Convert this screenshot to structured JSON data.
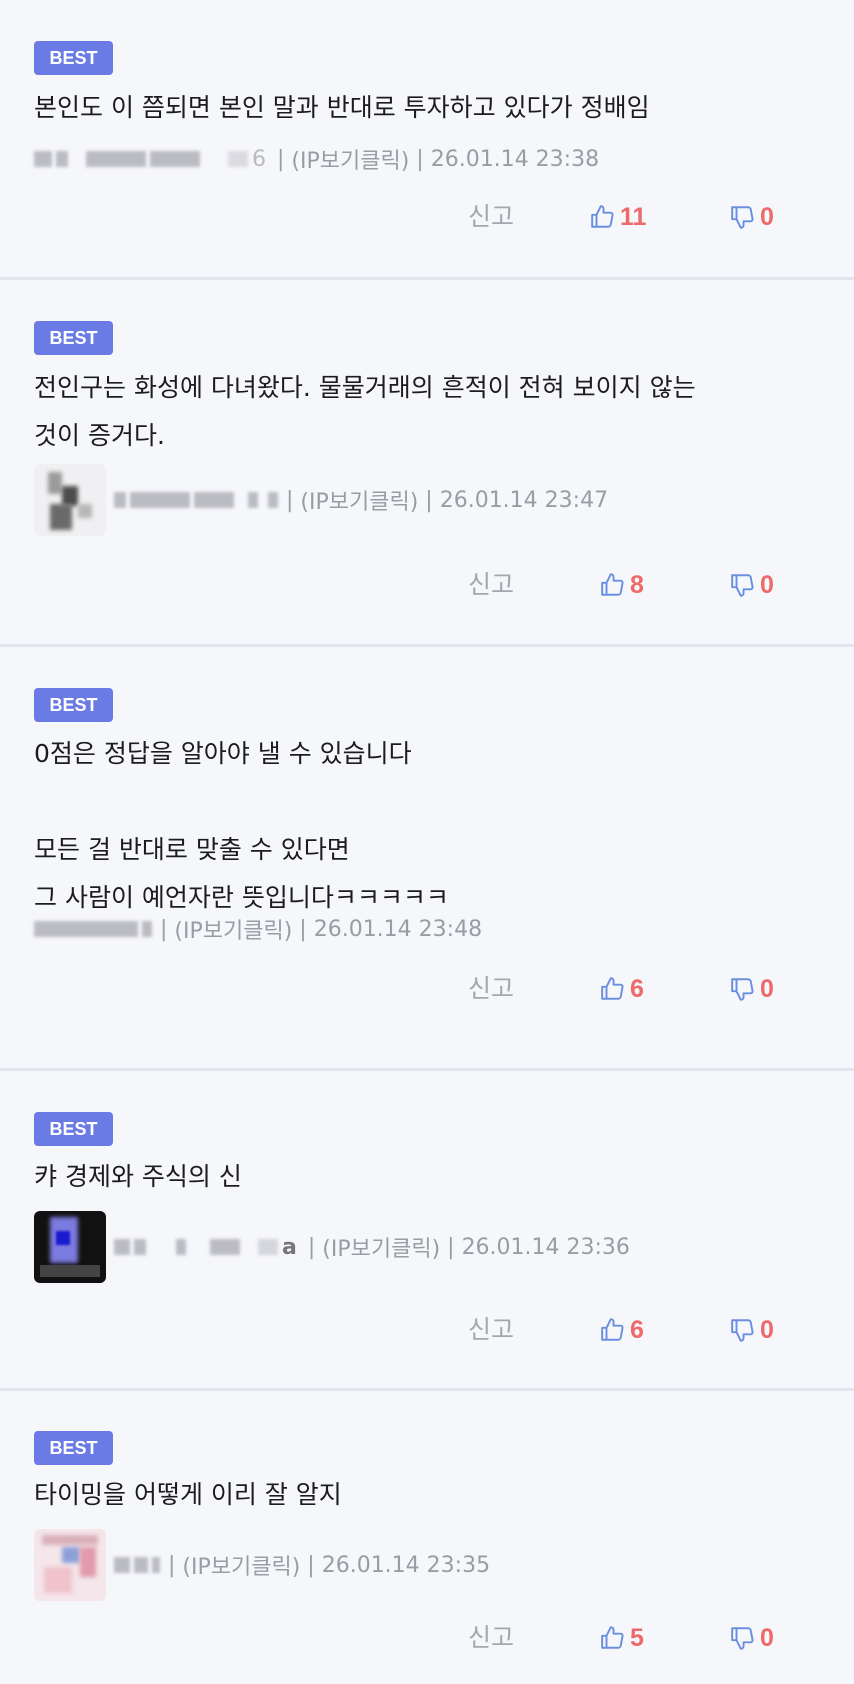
{
  "badge_label": "BEST",
  "report_label": "신고",
  "colors": {
    "badge": "#6b7be6",
    "count": "#ee6a6a",
    "thumb": "#6b8fe0",
    "meta": "#9a9ca4"
  },
  "comments": [
    {
      "text": "본인도 이 쯤되면 본인 말과 반대로 투자하고 있다가 정배임",
      "nick_tail": "6",
      "ip_label": "(IP보기클릭)",
      "timestamp": "26.01.14 23:38",
      "likes": "11",
      "dislikes": "0"
    },
    {
      "text": "전인구는 화성에 다녀왔다. 물물거래의 흔적이 전혀 보이지 않는\n것이 증거다.",
      "nick_tail": "",
      "ip_label": "(IP보기클릭)",
      "timestamp": "26.01.14 23:47",
      "likes": "8",
      "dislikes": "0"
    },
    {
      "text": "0점은 정답을 알아야 낼 수 있습니다\n\n모든 걸 반대로 맞출 수 있다면\n그 사람이 예언자란 뜻입니다ㅋㅋㅋㅋㅋ",
      "nick_tail": "",
      "ip_label": "(IP보기클릭)",
      "timestamp": "26.01.14 23:48",
      "likes": "6",
      "dislikes": "0"
    },
    {
      "text": "캬 경제와 주식의 신",
      "nick_tail": "a",
      "ip_label": "(IP보기클릭)",
      "timestamp": "26.01.14 23:36",
      "likes": "6",
      "dislikes": "0"
    },
    {
      "text": "타이밍을 어떻게 이리 잘 알지",
      "nick_tail": "",
      "ip_label": "(IP보기클릭)",
      "timestamp": "26.01.14 23:35",
      "likes": "5",
      "dislikes": "0"
    }
  ]
}
